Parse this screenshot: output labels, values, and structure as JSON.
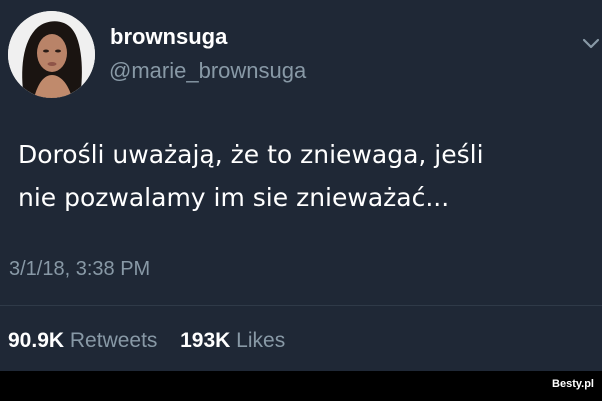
{
  "author": {
    "display_name": "brownsuga",
    "handle": "@marie_brownsuga"
  },
  "tweet": {
    "lines": [
      "Dorośli uważają, że to zniewaga, jeśli",
      "nie pozwalamy im sie znieważać..."
    ],
    "timestamp": "3/1/18, 3:38 PM"
  },
  "stats": {
    "retweets_count": "90.9K",
    "retweets_label": "Retweets",
    "likes_count": "193K",
    "likes_label": "Likes"
  },
  "watermark": {
    "text": "Besty.pl"
  },
  "colors": {
    "background": "#1f2836",
    "primary_text": "#ffffff",
    "secondary_text": "#8899a6"
  },
  "icons": {
    "menu": "chevron-down-icon"
  }
}
